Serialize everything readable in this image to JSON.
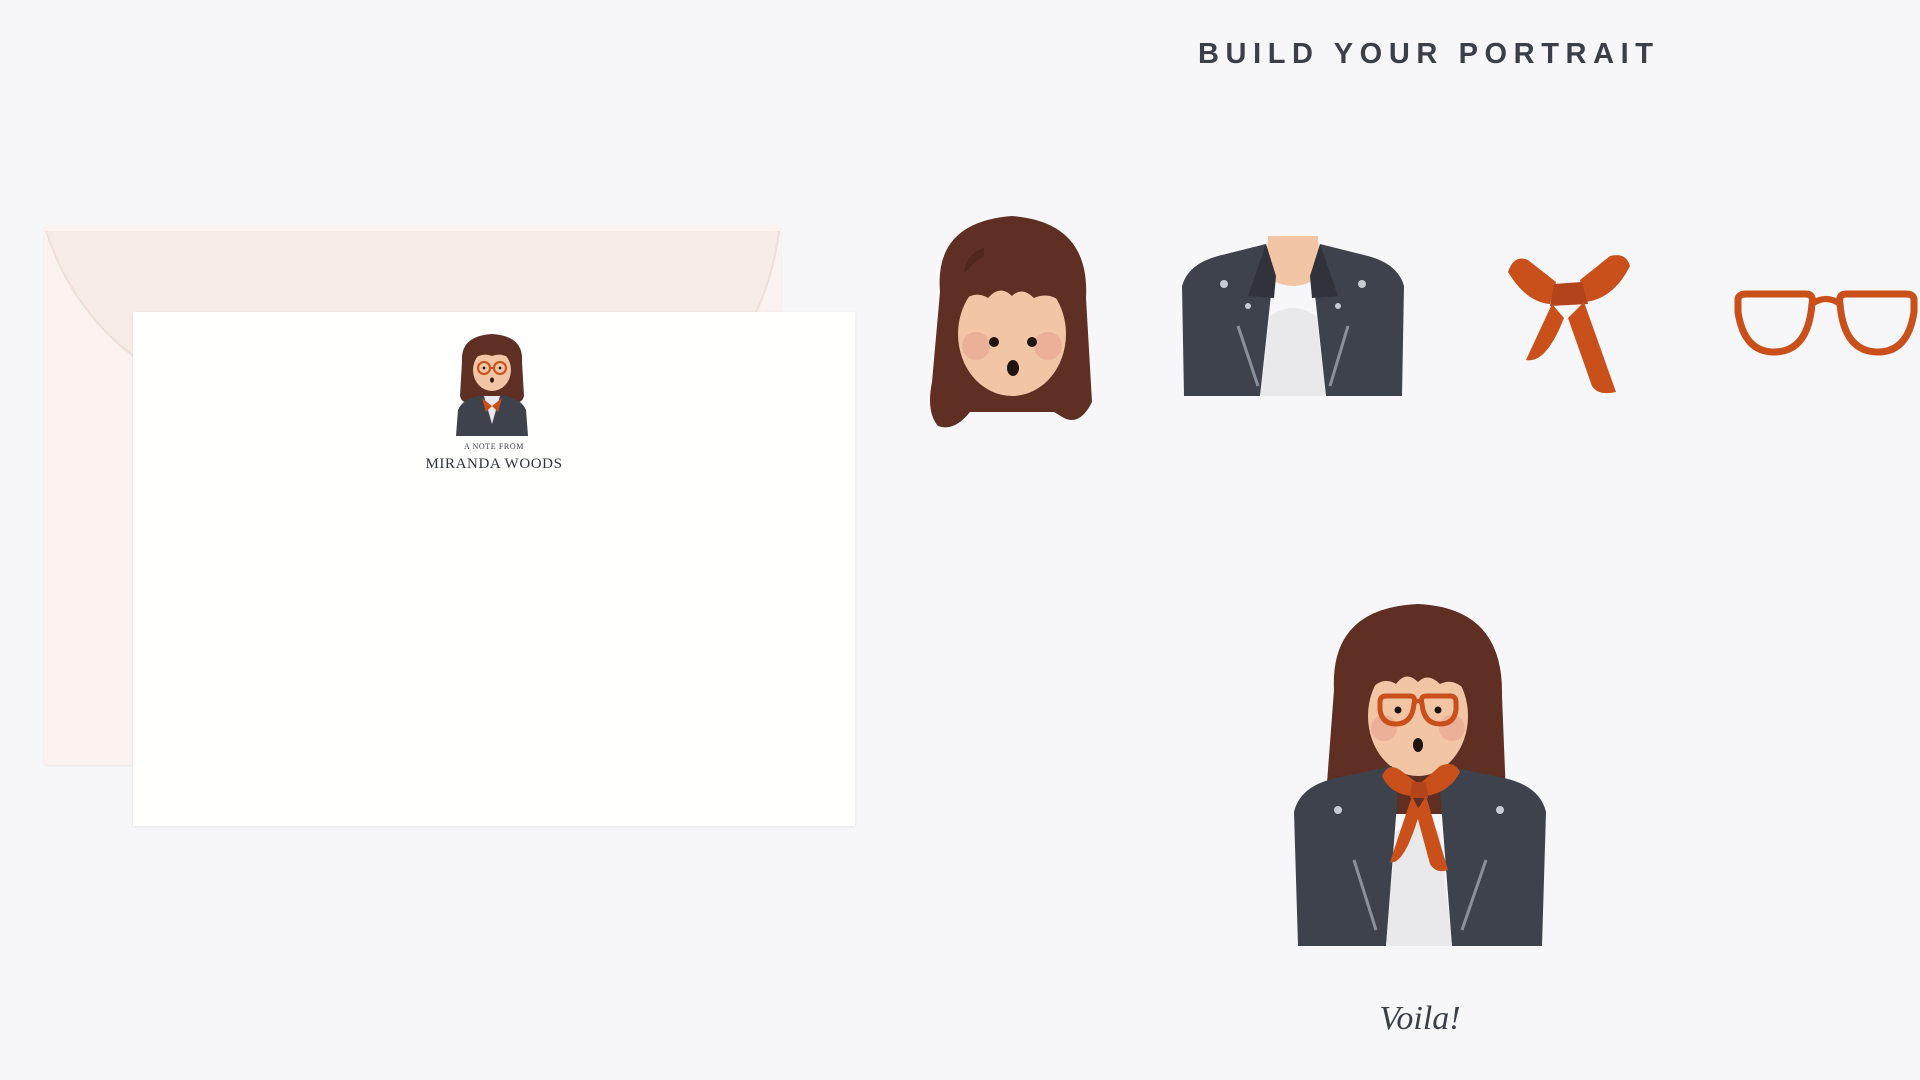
{
  "headline": "BUILD YOUR PORTRAIT",
  "card": {
    "note_from": "A NOTE FROM",
    "name": "MIRANDA WOODS"
  },
  "parts": [
    "hair-icon",
    "jacket-icon",
    "scarf-icon",
    "glasses-icon"
  ],
  "caption": "Voila!",
  "colors": {
    "background": "#f7f7f9",
    "hair": "#5e2f22",
    "skin": "#f2c5a5",
    "jacket": "#3e424c",
    "accent_orange": "#c9501a",
    "envelope": "#fbf3f0",
    "card": "#fffffd"
  }
}
